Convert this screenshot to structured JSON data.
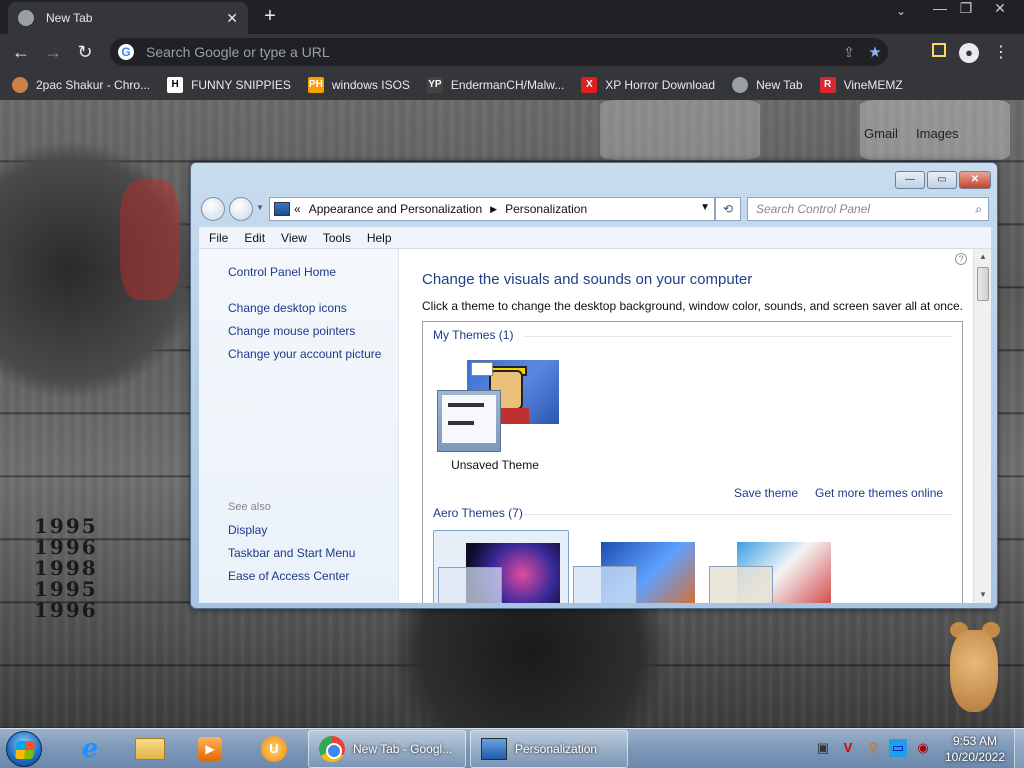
{
  "chrome": {
    "tab_title": "New Tab",
    "tab_close": "✕",
    "new_tab": "+",
    "window_controls": [
      "—",
      "❐",
      "✕"
    ],
    "omnibox_placeholder": "Search Google or type a URL",
    "omnibox_g": "G",
    "bookmarks": [
      {
        "label": "2pac Shakur - Chro...",
        "icon": "2pac-icon",
        "icon_text": "",
        "color": "#c9824a"
      },
      {
        "label": "FUNNY SNIPPIES",
        "icon": "h-icon",
        "icon_text": "H",
        "color": "#ffffff"
      },
      {
        "label": "windows ISOS",
        "icon": "ph-icon",
        "icon_text": "PH",
        "color": "#f7a000"
      },
      {
        "label": "EndermanCH/Malw...",
        "icon": "yp-icon",
        "icon_text": "YP",
        "color": "#444444"
      },
      {
        "label": "XP Horror Download",
        "icon": "x-icon",
        "icon_text": "X",
        "color": "#e02020"
      },
      {
        "label": "New Tab",
        "icon": "chrome-icon",
        "icon_text": "",
        "color": "#9aa0a6"
      },
      {
        "label": "VineMEMZ",
        "icon": "r-icon",
        "icon_text": "R",
        "color": "#d8262f"
      }
    ]
  },
  "desktop": {
    "years": [
      "1995",
      "1996",
      "1998",
      "1995",
      "1996"
    ],
    "gmail": "Gmail",
    "images": "Images"
  },
  "cp": {
    "address": {
      "chevrons": "«",
      "crumb1": "Appearance and Personalization",
      "sep": "▶",
      "crumb2": "Personalization",
      "dropdown": "▼",
      "refresh": "⟲"
    },
    "search_placeholder": "Search Control Panel",
    "search_icon": "⌕",
    "menu": [
      "File",
      "Edit",
      "View",
      "Tools",
      "Help"
    ],
    "left_links": [
      "Control Panel Home",
      "Change desktop icons",
      "Change mouse pointers",
      "Change your account picture"
    ],
    "see_also": "See also",
    "see_also_links": [
      "Display",
      "Taskbar and Start Menu",
      "Ease of Access Center"
    ],
    "help": "?",
    "title": "Change the visuals and sounds on your computer",
    "description": "Click a theme to change the desktop background, window color, sounds, and screen saver all at once.",
    "my_themes": "My Themes (1)",
    "unsaved_theme": "Unsaved Theme",
    "save_theme": "Save theme",
    "get_more": "Get more themes online",
    "aero_themes": "Aero Themes (7)",
    "caption": {
      "min": "—",
      "max": "▭",
      "close": "✕"
    }
  },
  "taskbar": {
    "tasks": [
      {
        "label": "New Tab - Googl...",
        "icon": "chrome-icon"
      },
      {
        "label": "Personalization",
        "icon": "control-panel-icon"
      }
    ],
    "pins": {
      "ie": "e",
      "wmp": "▶",
      "uc": "U"
    },
    "tray_icons": [
      "▣",
      "V",
      "⚲",
      "▭",
      "◉"
    ],
    "time": "9:53 AM",
    "date": "10/20/2022"
  }
}
